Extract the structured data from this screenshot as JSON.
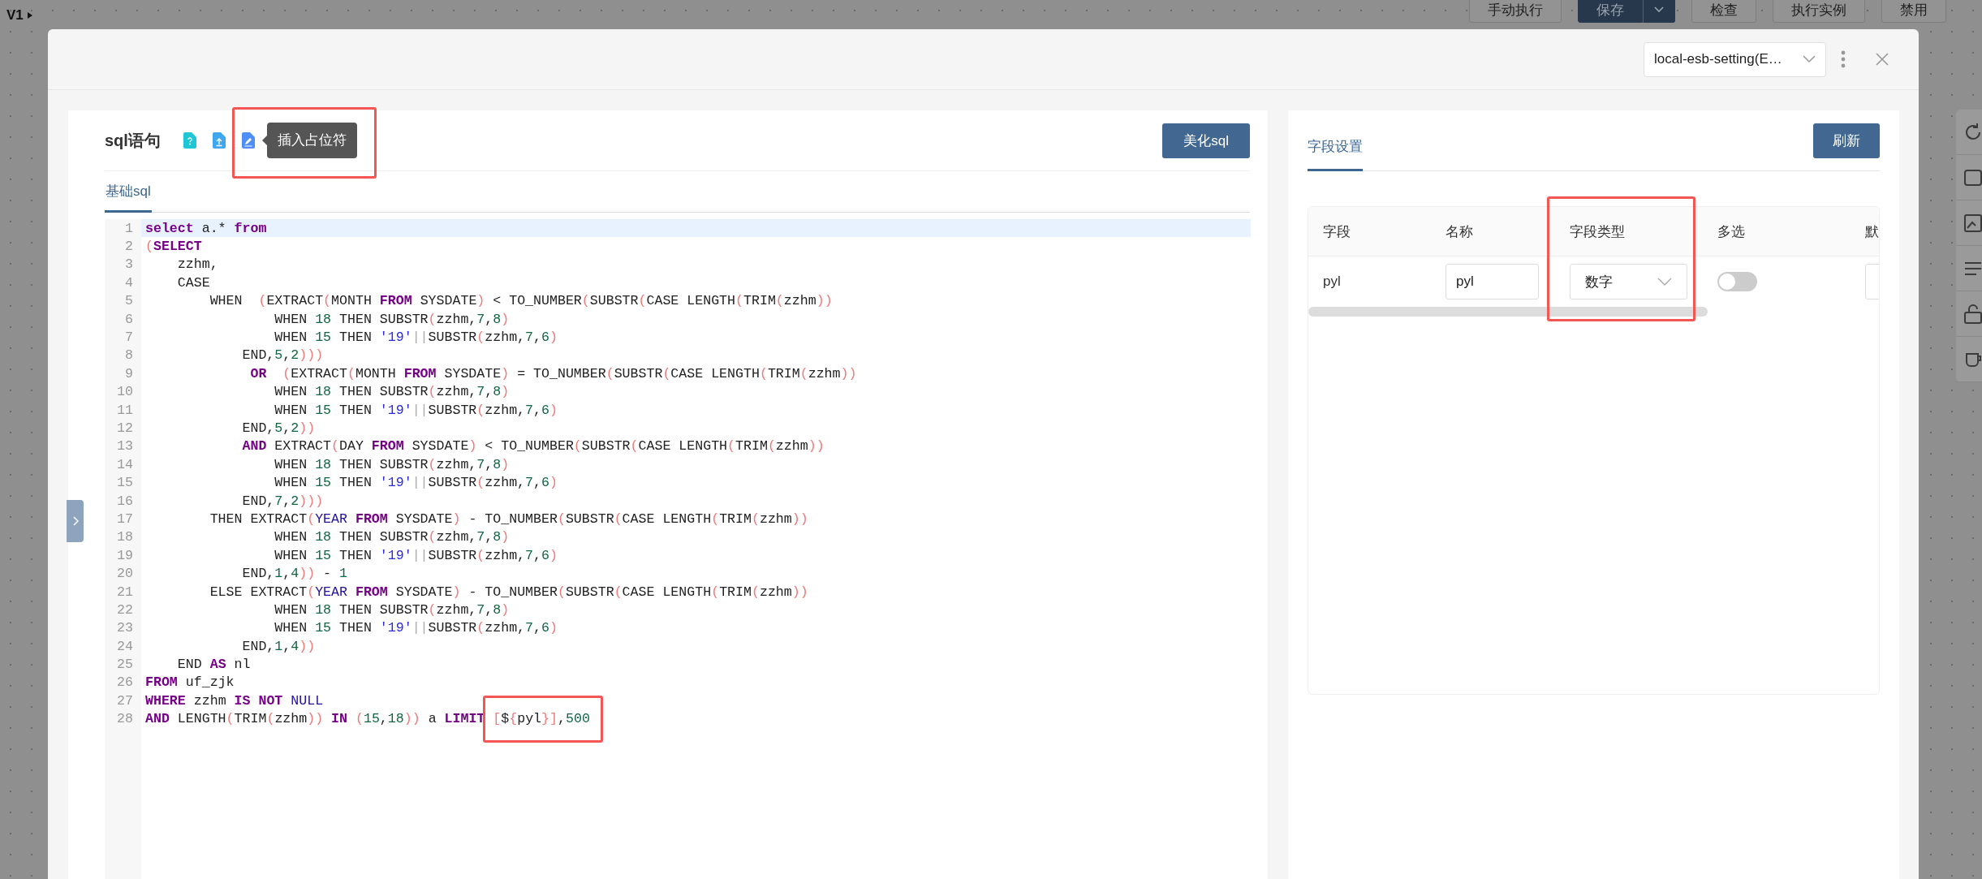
{
  "canvas": {
    "version": "V1",
    "buttons": [
      {
        "label": "手动执行",
        "kind": "default"
      },
      {
        "label": "保存",
        "kind": "split-primary"
      },
      {
        "label": "检查",
        "kind": "default"
      },
      {
        "label": "执行实例",
        "kind": "default"
      },
      {
        "label": "禁用",
        "kind": "default"
      }
    ]
  },
  "dialog": {
    "datasource": "local-esb-setting(E…"
  },
  "sql_panel": {
    "title": "sql语句",
    "icons": [
      {
        "kind": "help"
      },
      {
        "kind": "upload"
      },
      {
        "kind": "edit",
        "tooltip": "插入占位符",
        "highlighted": true
      }
    ],
    "beautify_button": "美化sql",
    "tabs": [
      {
        "label": "基础sql",
        "selected": true
      }
    ],
    "code_lines": [
      {
        "number": "1",
        "active": true,
        "tokens": [
          {
            "kind": "kw",
            "text": "select"
          },
          {
            "kind": "t",
            "text": " a.* "
          },
          {
            "kind": "kw",
            "text": "from"
          }
        ]
      },
      {
        "number": "2",
        "active": false,
        "tokens": [
          {
            "kind": "br",
            "text": "("
          },
          {
            "kind": "kw",
            "text": "SELECT"
          }
        ]
      },
      {
        "number": "3",
        "active": false,
        "tokens": [
          {
            "kind": "t",
            "text": "    zzhm,"
          }
        ]
      },
      {
        "number": "4",
        "active": false,
        "tokens": [
          {
            "kind": "t",
            "text": "    CASE"
          }
        ]
      },
      {
        "number": "5",
        "active": false,
        "tokens": [
          {
            "kind": "t",
            "text": "        WHEN  "
          },
          {
            "kind": "br",
            "text": "("
          },
          {
            "kind": "t",
            "text": "EXTRACT"
          },
          {
            "kind": "br",
            "text": "("
          },
          {
            "kind": "t",
            "text": "MONTH "
          },
          {
            "kind": "kw",
            "text": "FROM"
          },
          {
            "kind": "t",
            "text": " SYSDATE"
          },
          {
            "kind": "br",
            "text": ")"
          },
          {
            "kind": "t",
            "text": " < TO_NUMBER"
          },
          {
            "kind": "br",
            "text": "("
          },
          {
            "kind": "t",
            "text": "SUBSTR"
          },
          {
            "kind": "br",
            "text": "("
          },
          {
            "kind": "t",
            "text": "CASE LENGTH"
          },
          {
            "kind": "br",
            "text": "("
          },
          {
            "kind": "t",
            "text": "TRIM"
          },
          {
            "kind": "br",
            "text": "("
          },
          {
            "kind": "t",
            "text": "zzhm"
          },
          {
            "kind": "br",
            "text": "))"
          }
        ]
      },
      {
        "number": "6",
        "active": false,
        "tokens": [
          {
            "kind": "t",
            "text": "                WHEN "
          },
          {
            "kind": "num",
            "text": "18"
          },
          {
            "kind": "t",
            "text": " THEN SUBSTR"
          },
          {
            "kind": "br",
            "text": "("
          },
          {
            "kind": "t",
            "text": "zzhm,"
          },
          {
            "kind": "num",
            "text": "7"
          },
          {
            "kind": "t",
            "text": ","
          },
          {
            "kind": "num",
            "text": "8"
          },
          {
            "kind": "br",
            "text": ")"
          }
        ]
      },
      {
        "number": "7",
        "active": false,
        "tokens": [
          {
            "kind": "t",
            "text": "                WHEN "
          },
          {
            "kind": "num",
            "text": "15"
          },
          {
            "kind": "t",
            "text": " THEN "
          },
          {
            "kind": "str",
            "text": "'19'"
          },
          {
            "kind": "op",
            "text": "||"
          },
          {
            "kind": "t",
            "text": "SUBSTR"
          },
          {
            "kind": "br",
            "text": "("
          },
          {
            "kind": "t",
            "text": "zzhm,"
          },
          {
            "kind": "num",
            "text": "7"
          },
          {
            "kind": "t",
            "text": ","
          },
          {
            "kind": "num",
            "text": "6"
          },
          {
            "kind": "br",
            "text": ")"
          }
        ]
      },
      {
        "number": "8",
        "active": false,
        "tokens": [
          {
            "kind": "t",
            "text": "            END,"
          },
          {
            "kind": "num",
            "text": "5"
          },
          {
            "kind": "t",
            "text": ","
          },
          {
            "kind": "num",
            "text": "2"
          },
          {
            "kind": "br",
            "text": ")))"
          }
        ]
      },
      {
        "number": "9",
        "active": false,
        "tokens": [
          {
            "kind": "kw",
            "text": "             OR"
          },
          {
            "kind": "br",
            "text": "  ("
          },
          {
            "kind": "t",
            "text": "EXTRACT"
          },
          {
            "kind": "br",
            "text": "("
          },
          {
            "kind": "t",
            "text": "MONTH "
          },
          {
            "kind": "kw",
            "text": "FROM"
          },
          {
            "kind": "t",
            "text": " SYSDATE"
          },
          {
            "kind": "br",
            "text": ")"
          },
          {
            "kind": "t",
            "text": " = TO_NUMBER"
          },
          {
            "kind": "br",
            "text": "("
          },
          {
            "kind": "t",
            "text": "SUBSTR"
          },
          {
            "kind": "br",
            "text": "("
          },
          {
            "kind": "t",
            "text": "CASE LENGTH"
          },
          {
            "kind": "br",
            "text": "("
          },
          {
            "kind": "t",
            "text": "TRIM"
          },
          {
            "kind": "br",
            "text": "("
          },
          {
            "kind": "t",
            "text": "zzhm"
          },
          {
            "kind": "br",
            "text": "))"
          }
        ]
      },
      {
        "number": "10",
        "active": false,
        "tokens": [
          {
            "kind": "t",
            "text": "                WHEN "
          },
          {
            "kind": "num",
            "text": "18"
          },
          {
            "kind": "t",
            "text": " THEN SUBSTR"
          },
          {
            "kind": "br",
            "text": "("
          },
          {
            "kind": "t",
            "text": "zzhm,"
          },
          {
            "kind": "num",
            "text": "7"
          },
          {
            "kind": "t",
            "text": ","
          },
          {
            "kind": "num",
            "text": "8"
          },
          {
            "kind": "br",
            "text": ")"
          }
        ]
      },
      {
        "number": "11",
        "active": false,
        "tokens": [
          {
            "kind": "t",
            "text": "                WHEN "
          },
          {
            "kind": "num",
            "text": "15"
          },
          {
            "kind": "t",
            "text": " THEN "
          },
          {
            "kind": "str",
            "text": "'19'"
          },
          {
            "kind": "op",
            "text": "||"
          },
          {
            "kind": "t",
            "text": "SUBSTR"
          },
          {
            "kind": "br",
            "text": "("
          },
          {
            "kind": "t",
            "text": "zzhm,"
          },
          {
            "kind": "num",
            "text": "7"
          },
          {
            "kind": "t",
            "text": ","
          },
          {
            "kind": "num",
            "text": "6"
          },
          {
            "kind": "br",
            "text": ")"
          }
        ]
      },
      {
        "number": "12",
        "active": false,
        "tokens": [
          {
            "kind": "t",
            "text": "            END,"
          },
          {
            "kind": "num",
            "text": "5"
          },
          {
            "kind": "t",
            "text": ","
          },
          {
            "kind": "num",
            "text": "2"
          },
          {
            "kind": "br",
            "text": "))"
          }
        ]
      },
      {
        "number": "13",
        "active": false,
        "tokens": [
          {
            "kind": "kw",
            "text": "            AND"
          },
          {
            "kind": "t",
            "text": " EXTRACT"
          },
          {
            "kind": "br",
            "text": "("
          },
          {
            "kind": "t",
            "text": "DAY "
          },
          {
            "kind": "kw",
            "text": "FROM"
          },
          {
            "kind": "t",
            "text": " SYSDATE"
          },
          {
            "kind": "br",
            "text": ")"
          },
          {
            "kind": "t",
            "text": " < TO_NUMBER"
          },
          {
            "kind": "br",
            "text": "("
          },
          {
            "kind": "t",
            "text": "SUBSTR"
          },
          {
            "kind": "br",
            "text": "("
          },
          {
            "kind": "t",
            "text": "CASE LENGTH"
          },
          {
            "kind": "br",
            "text": "("
          },
          {
            "kind": "t",
            "text": "TRIM"
          },
          {
            "kind": "br",
            "text": "("
          },
          {
            "kind": "t",
            "text": "zzhm"
          },
          {
            "kind": "br",
            "text": "))"
          }
        ]
      },
      {
        "number": "14",
        "active": false,
        "tokens": [
          {
            "kind": "t",
            "text": "                WHEN "
          },
          {
            "kind": "num",
            "text": "18"
          },
          {
            "kind": "t",
            "text": " THEN SUBSTR"
          },
          {
            "kind": "br",
            "text": "("
          },
          {
            "kind": "t",
            "text": "zzhm,"
          },
          {
            "kind": "num",
            "text": "7"
          },
          {
            "kind": "t",
            "text": ","
          },
          {
            "kind": "num",
            "text": "8"
          },
          {
            "kind": "br",
            "text": ")"
          }
        ]
      },
      {
        "number": "15",
        "active": false,
        "tokens": [
          {
            "kind": "t",
            "text": "                WHEN "
          },
          {
            "kind": "num",
            "text": "15"
          },
          {
            "kind": "t",
            "text": " THEN "
          },
          {
            "kind": "str",
            "text": "'19'"
          },
          {
            "kind": "op",
            "text": "||"
          },
          {
            "kind": "t",
            "text": "SUBSTR"
          },
          {
            "kind": "br",
            "text": "("
          },
          {
            "kind": "t",
            "text": "zzhm,"
          },
          {
            "kind": "num",
            "text": "7"
          },
          {
            "kind": "t",
            "text": ","
          },
          {
            "kind": "num",
            "text": "6"
          },
          {
            "kind": "br",
            "text": ")"
          }
        ]
      },
      {
        "number": "16",
        "active": false,
        "tokens": [
          {
            "kind": "t",
            "text": "            END,"
          },
          {
            "kind": "num",
            "text": "7"
          },
          {
            "kind": "t",
            "text": ","
          },
          {
            "kind": "num",
            "text": "2"
          },
          {
            "kind": "br",
            "text": ")))"
          }
        ]
      },
      {
        "number": "17",
        "active": false,
        "tokens": [
          {
            "kind": "t",
            "text": "        THEN EXTRACT"
          },
          {
            "kind": "br",
            "text": "("
          },
          {
            "kind": "atom",
            "text": "YEAR "
          },
          {
            "kind": "kw",
            "text": "FROM"
          },
          {
            "kind": "t",
            "text": " SYSDATE"
          },
          {
            "kind": "br",
            "text": ")"
          },
          {
            "kind": "t",
            "text": " - TO_NUMBER"
          },
          {
            "kind": "br",
            "text": "("
          },
          {
            "kind": "t",
            "text": "SUBSTR"
          },
          {
            "kind": "br",
            "text": "("
          },
          {
            "kind": "t",
            "text": "CASE LENGTH"
          },
          {
            "kind": "br",
            "text": "("
          },
          {
            "kind": "t",
            "text": "TRIM"
          },
          {
            "kind": "br",
            "text": "("
          },
          {
            "kind": "t",
            "text": "zzhm"
          },
          {
            "kind": "br",
            "text": "))"
          }
        ]
      },
      {
        "number": "18",
        "active": false,
        "tokens": [
          {
            "kind": "t",
            "text": "                WHEN "
          },
          {
            "kind": "num",
            "text": "18"
          },
          {
            "kind": "t",
            "text": " THEN SUBSTR"
          },
          {
            "kind": "br",
            "text": "("
          },
          {
            "kind": "t",
            "text": "zzhm,"
          },
          {
            "kind": "num",
            "text": "7"
          },
          {
            "kind": "t",
            "text": ","
          },
          {
            "kind": "num",
            "text": "8"
          },
          {
            "kind": "br",
            "text": ")"
          }
        ]
      },
      {
        "number": "19",
        "active": false,
        "tokens": [
          {
            "kind": "t",
            "text": "                WHEN "
          },
          {
            "kind": "num",
            "text": "15"
          },
          {
            "kind": "t",
            "text": " THEN "
          },
          {
            "kind": "str",
            "text": "'19'"
          },
          {
            "kind": "op",
            "text": "||"
          },
          {
            "kind": "t",
            "text": "SUBSTR"
          },
          {
            "kind": "br",
            "text": "("
          },
          {
            "kind": "t",
            "text": "zzhm,"
          },
          {
            "kind": "num",
            "text": "7"
          },
          {
            "kind": "t",
            "text": ","
          },
          {
            "kind": "num",
            "text": "6"
          },
          {
            "kind": "br",
            "text": ")"
          }
        ]
      },
      {
        "number": "20",
        "active": false,
        "tokens": [
          {
            "kind": "t",
            "text": "            END,"
          },
          {
            "kind": "num",
            "text": "1"
          },
          {
            "kind": "t",
            "text": ","
          },
          {
            "kind": "num",
            "text": "4"
          },
          {
            "kind": "br",
            "text": "))"
          },
          {
            "kind": "t",
            "text": " - "
          },
          {
            "kind": "num",
            "text": "1"
          }
        ]
      },
      {
        "number": "21",
        "active": false,
        "tokens": [
          {
            "kind": "t",
            "text": "        ELSE EXTRACT"
          },
          {
            "kind": "br",
            "text": "("
          },
          {
            "kind": "atom",
            "text": "YEAR "
          },
          {
            "kind": "kw",
            "text": "FROM"
          },
          {
            "kind": "t",
            "text": " SYSDATE"
          },
          {
            "kind": "br",
            "text": ")"
          },
          {
            "kind": "t",
            "text": " - TO_NUMBER"
          },
          {
            "kind": "br",
            "text": "("
          },
          {
            "kind": "t",
            "text": "SUBSTR"
          },
          {
            "kind": "br",
            "text": "("
          },
          {
            "kind": "t",
            "text": "CASE LENGTH"
          },
          {
            "kind": "br",
            "text": "("
          },
          {
            "kind": "t",
            "text": "TRIM"
          },
          {
            "kind": "br",
            "text": "("
          },
          {
            "kind": "t",
            "text": "zzhm"
          },
          {
            "kind": "br",
            "text": "))"
          }
        ]
      },
      {
        "number": "22",
        "active": false,
        "tokens": [
          {
            "kind": "t",
            "text": "                WHEN "
          },
          {
            "kind": "num",
            "text": "18"
          },
          {
            "kind": "t",
            "text": " THEN SUBSTR"
          },
          {
            "kind": "br",
            "text": "("
          },
          {
            "kind": "t",
            "text": "zzhm,"
          },
          {
            "kind": "num",
            "text": "7"
          },
          {
            "kind": "t",
            "text": ","
          },
          {
            "kind": "num",
            "text": "8"
          },
          {
            "kind": "br",
            "text": ")"
          }
        ]
      },
      {
        "number": "23",
        "active": false,
        "tokens": [
          {
            "kind": "t",
            "text": "                WHEN "
          },
          {
            "kind": "num",
            "text": "15"
          },
          {
            "kind": "t",
            "text": " THEN "
          },
          {
            "kind": "str",
            "text": "'19'"
          },
          {
            "kind": "op",
            "text": "||"
          },
          {
            "kind": "t",
            "text": "SUBSTR"
          },
          {
            "kind": "br",
            "text": "("
          },
          {
            "kind": "t",
            "text": "zzhm,"
          },
          {
            "kind": "num",
            "text": "7"
          },
          {
            "kind": "t",
            "text": ","
          },
          {
            "kind": "num",
            "text": "6"
          },
          {
            "kind": "br",
            "text": ")"
          }
        ]
      },
      {
        "number": "24",
        "active": false,
        "tokens": [
          {
            "kind": "t",
            "text": "            END,"
          },
          {
            "kind": "num",
            "text": "1"
          },
          {
            "kind": "t",
            "text": ","
          },
          {
            "kind": "num",
            "text": "4"
          },
          {
            "kind": "br",
            "text": "))"
          }
        ]
      },
      {
        "number": "25",
        "active": false,
        "tokens": [
          {
            "kind": "t",
            "text": "    END "
          },
          {
            "kind": "kw",
            "text": "AS"
          },
          {
            "kind": "t",
            "text": " nl"
          }
        ]
      },
      {
        "number": "26",
        "active": false,
        "tokens": [
          {
            "kind": "kw",
            "text": "FROM"
          },
          {
            "kind": "t",
            "text": " uf_zjk"
          }
        ]
      },
      {
        "number": "27",
        "active": false,
        "tokens": [
          {
            "kind": "kw",
            "text": "WHERE"
          },
          {
            "kind": "t",
            "text": " zzhm "
          },
          {
            "kind": "kw",
            "text": "IS NOT"
          },
          {
            "kind": "atom",
            "text": " NULL"
          }
        ]
      },
      {
        "number": "28",
        "active": false,
        "tokens": [
          {
            "kind": "kw",
            "text": "AND"
          },
          {
            "kind": "t",
            "text": " LENGTH"
          },
          {
            "kind": "br",
            "text": "("
          },
          {
            "kind": "t",
            "text": "TRIM"
          },
          {
            "kind": "br",
            "text": "("
          },
          {
            "kind": "t",
            "text": "zzhm"
          },
          {
            "kind": "br",
            "text": "))"
          },
          {
            "kind": "kw",
            "text": " IN"
          },
          {
            "kind": "br",
            "text": " ("
          },
          {
            "kind": "num",
            "text": "15"
          },
          {
            "kind": "t",
            "text": ","
          },
          {
            "kind": "num",
            "text": "18"
          },
          {
            "kind": "br",
            "text": "))"
          },
          {
            "kind": "t",
            "text": " a "
          },
          {
            "kind": "kw",
            "text": "LIMIT "
          },
          {
            "highlighted": true,
            "tokens": [
              {
                "kind": "br",
                "text": "["
              },
              {
                "kind": "t",
                "text": "$"
              },
              {
                "kind": "br",
                "text": "{"
              },
              {
                "kind": "t",
                "text": "pyl"
              },
              {
                "kind": "br",
                "text": "}]"
              },
              {
                "kind": "t",
                "text": ","
              },
              {
                "kind": "num",
                "text": "500"
              }
            ]
          }
        ]
      }
    ]
  },
  "fields_panel": {
    "tabs": [
      {
        "label": "字段设置",
        "selected": true
      }
    ],
    "refresh_button": "刷新",
    "columns": [
      {
        "label": "字段",
        "highlighted": false
      },
      {
        "label": "名称",
        "highlighted": false
      },
      {
        "label": "字段类型",
        "highlighted": true
      },
      {
        "label": "多选",
        "highlighted": false
      },
      {
        "label": "默",
        "highlighted": false
      }
    ],
    "rows": [
      {
        "field": "pyl",
        "name": "pyl",
        "type": "数字",
        "multiple": false
      }
    ]
  }
}
